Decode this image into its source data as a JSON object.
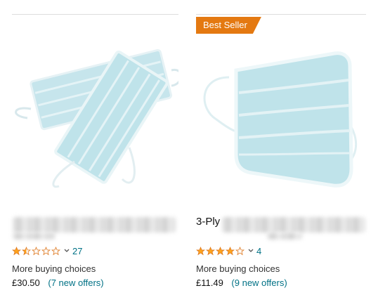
{
  "products": [
    {
      "title": "",
      "rating": 1.5,
      "max_rating": 5,
      "review_count": "27",
      "buying_choices_label": "More buying choices",
      "price": "£30.50",
      "offers": "(7 new offers)"
    },
    {
      "badge": "Best Seller",
      "title": "3-Ply",
      "rating": 4,
      "max_rating": 5,
      "review_count": "4",
      "buying_choices_label": "More buying choices",
      "price": "£11.49",
      "offers": "(9 new offers)"
    }
  ],
  "colors": {
    "star_fill": "#FFA41C",
    "star_stroke": "#DE7921",
    "link": "#007185",
    "badge": "#E47911",
    "mask": "#BFE3EA"
  },
  "icons": {
    "rating_chevron": "chevron-down-icon",
    "star": "star-icon"
  }
}
